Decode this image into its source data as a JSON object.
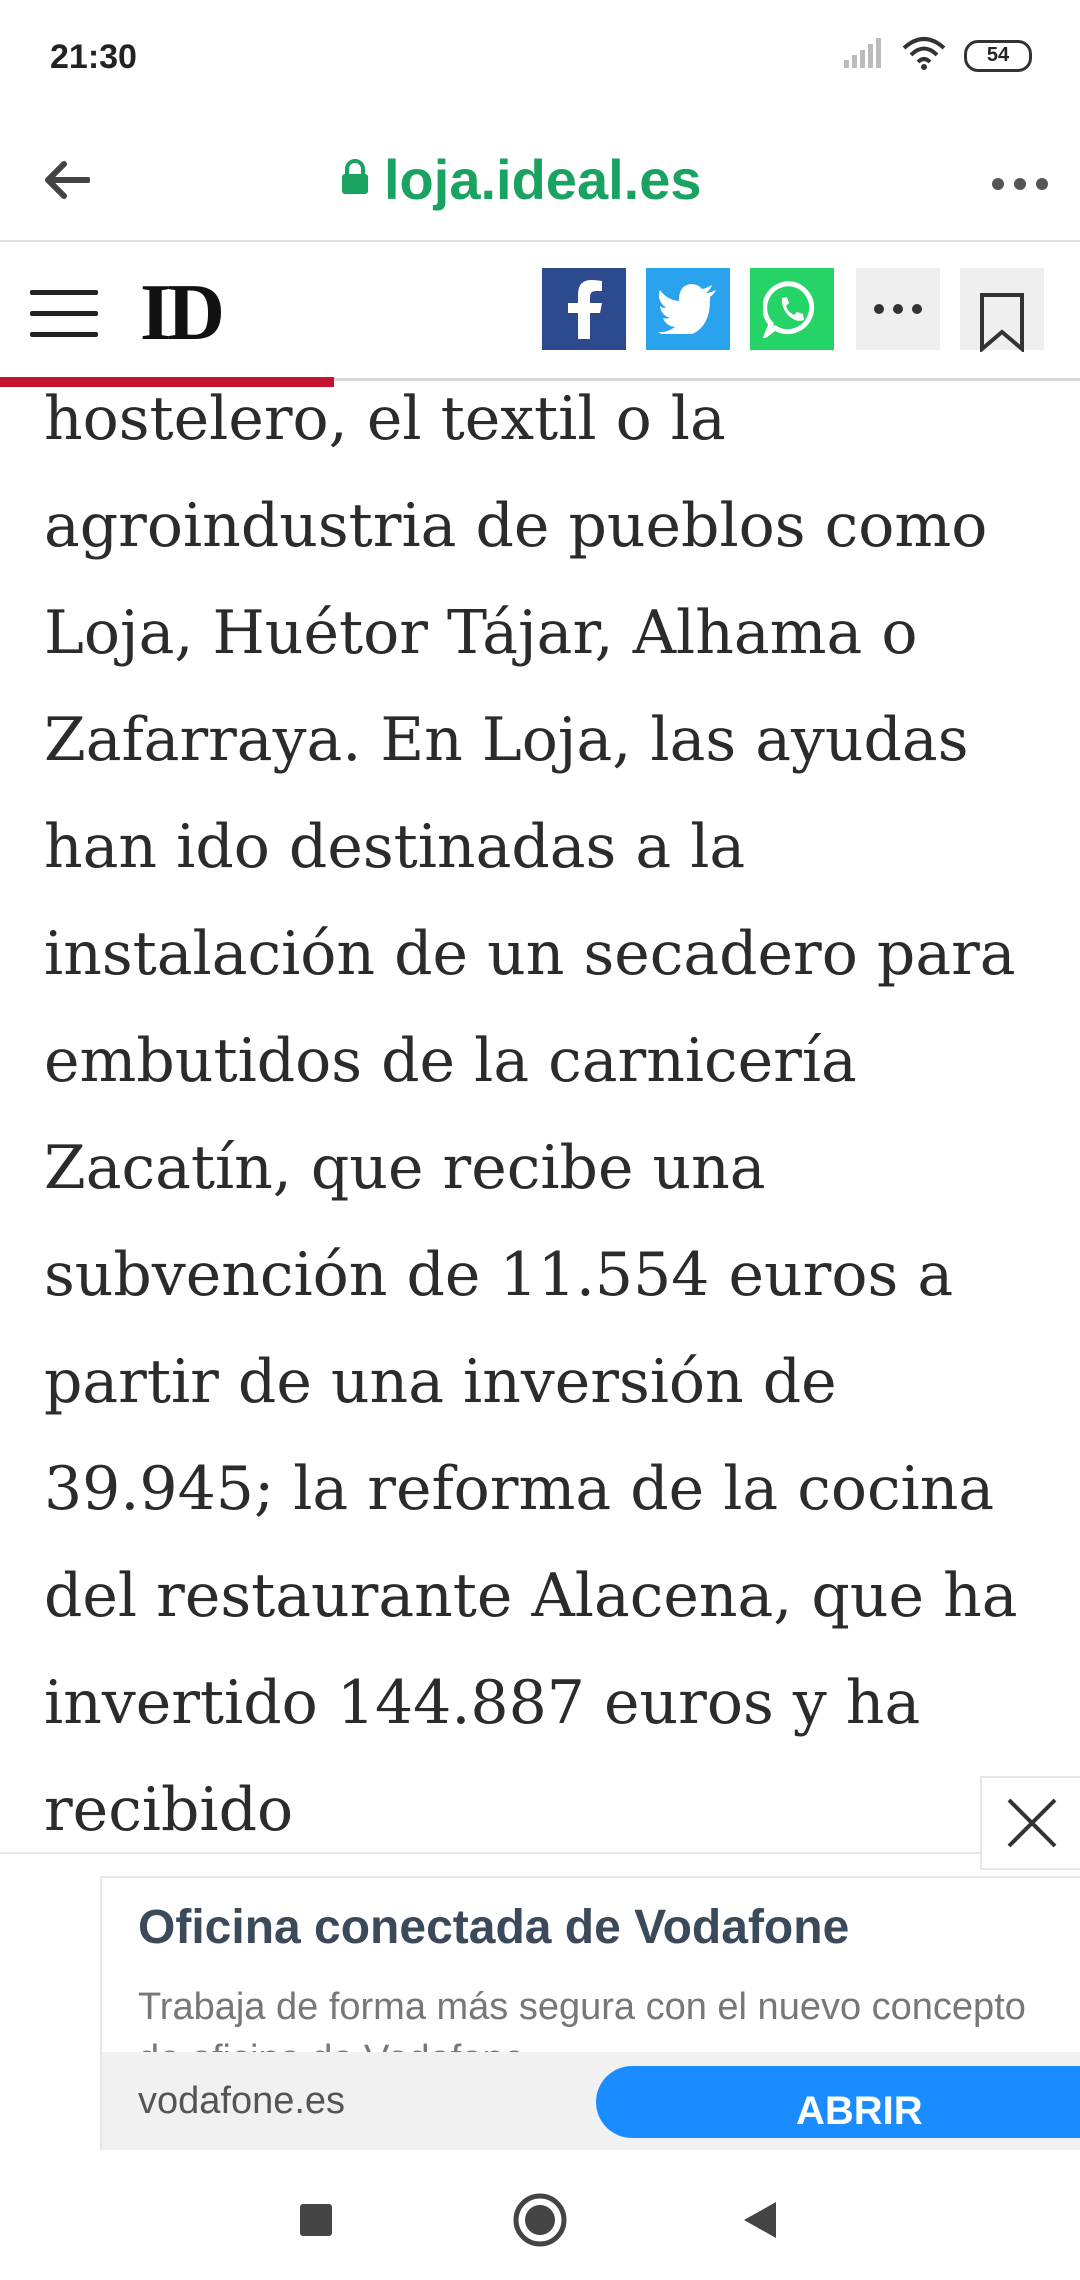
{
  "status_bar": {
    "time": "21:30",
    "battery": "54"
  },
  "browser": {
    "url": "loja.ideal.es"
  },
  "site": {
    "logo": "ID"
  },
  "article": {
    "text": "hostelero, el textil o la agroindustria de pueblos como Loja, Huétor Tájar, Alhama o Zafarraya. En Loja, las ayudas han ido destinadas a la instalación de un secadero para embutidos de la carnicería Zacatín, que recibe una subvención de 11.554 euros a partir de una inversión de 39.945; la reforma de la cocina del restaurante Alacena, que ha invertido 144.887 euros y ha recibido"
  },
  "ad": {
    "title": "Oficina conectada de Vodafone",
    "description": "Trabaja de forma más segura con el nuevo concepto",
    "description_line2": "de oficina de Vodafone",
    "domain": "vodafone.es",
    "cta": "ABRIR"
  },
  "colors": {
    "url_green": "#1aa260",
    "accent_red": "#c4122f",
    "facebook": "#2d4a8e",
    "twitter": "#2aa3ef",
    "whatsapp": "#25d366",
    "cta_blue": "#1a8cff"
  }
}
